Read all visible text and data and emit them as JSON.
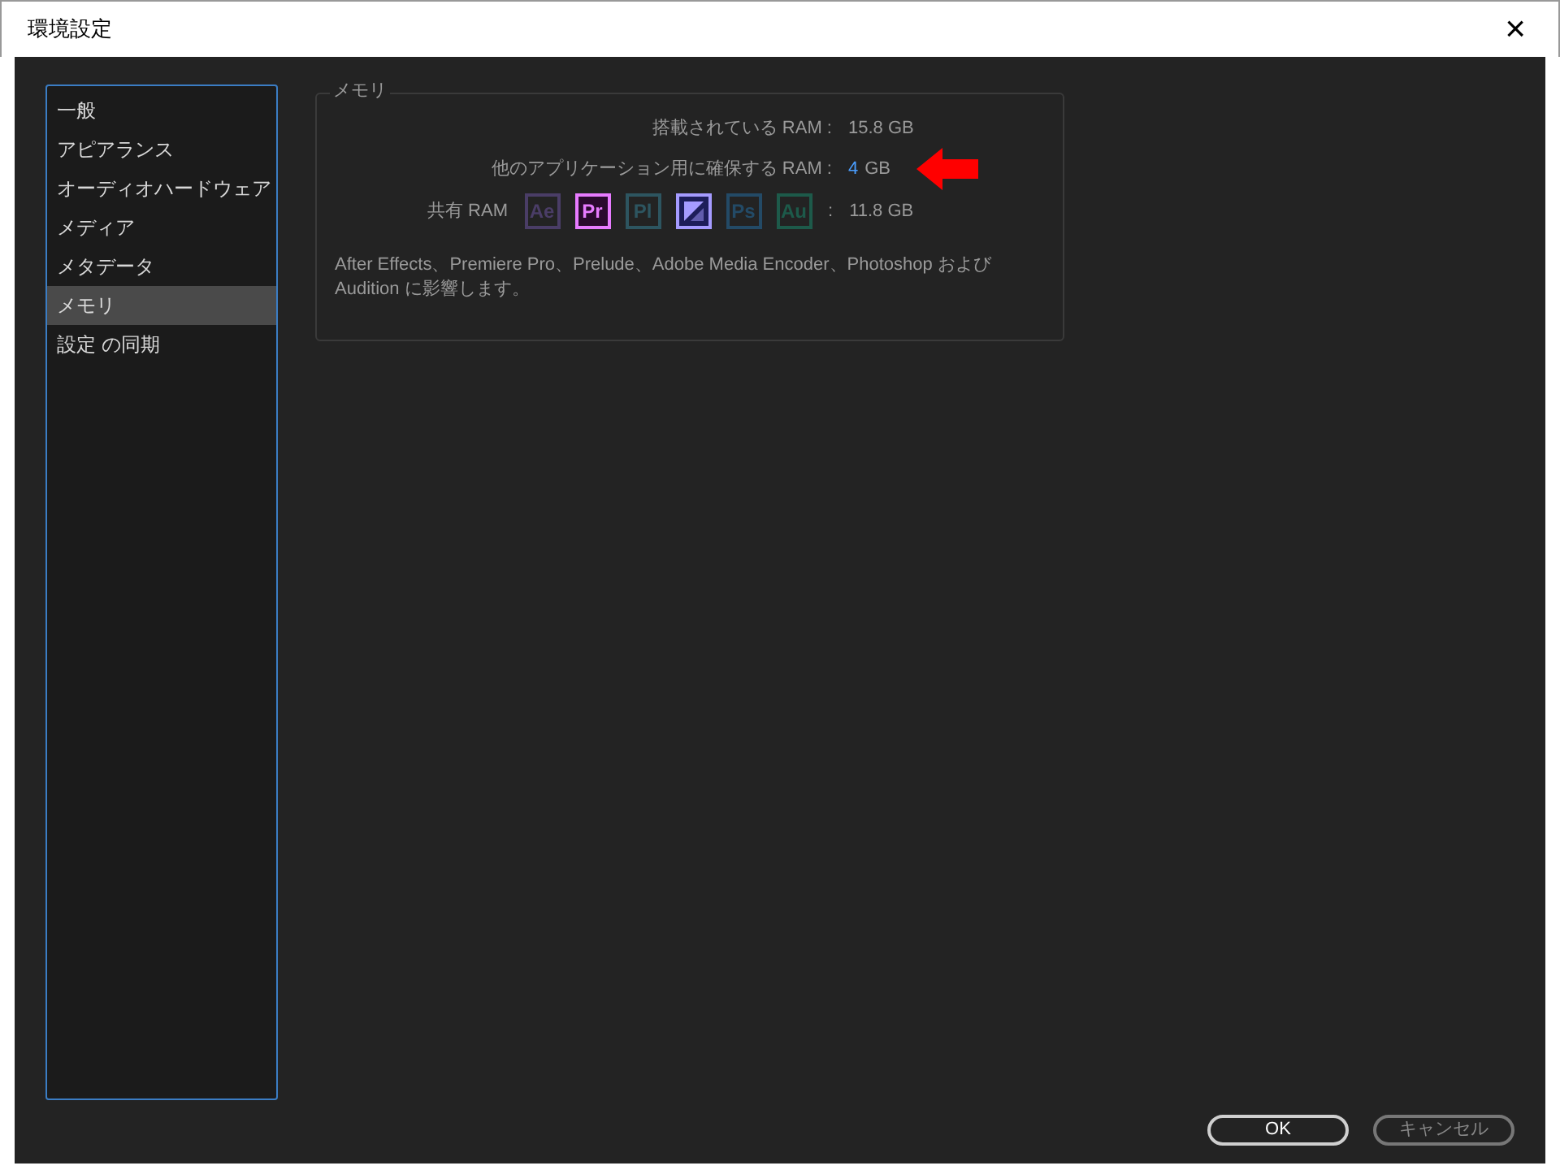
{
  "window": {
    "title": "環境設定",
    "close": "×"
  },
  "sidebar": {
    "items": [
      {
        "label": "一般",
        "selected": false
      },
      {
        "label": "アピアランス",
        "selected": false
      },
      {
        "label": "オーディオハードウェア",
        "selected": false
      },
      {
        "label": "メディア",
        "selected": false
      },
      {
        "label": "メタデータ",
        "selected": false
      },
      {
        "label": "メモリ",
        "selected": true
      },
      {
        "label": "設定 の同期",
        "selected": false
      }
    ]
  },
  "memory": {
    "title": "メモリ",
    "installed_label": "搭載されている RAM :",
    "installed_value": "15.8 GB",
    "reserved_label": "他のアプリケーション用に確保する RAM :",
    "reserved_value": "4",
    "reserved_unit": "GB",
    "shared_label": "共有 RAM",
    "apps": [
      {
        "kind": "text",
        "label": "Ae",
        "color": "#4a3d66",
        "active": false
      },
      {
        "kind": "text",
        "label": "Pr",
        "color": "#e77bff",
        "active": true
      },
      {
        "kind": "text",
        "label": "Pl",
        "color": "#2d5560",
        "active": false
      },
      {
        "kind": "encoder",
        "color": "#a59bff",
        "active": true
      },
      {
        "kind": "text",
        "label": "Ps",
        "color": "#234a66",
        "active": false
      },
      {
        "kind": "text",
        "label": "Au",
        "color": "#1d5a4a",
        "active": false
      }
    ],
    "shared_sep": ":",
    "shared_value": "11.8 GB",
    "note": "After  Effects、Premiere Pro、Prelude、Adobe Media Encoder、Photoshop および Audition に影響します。"
  },
  "buttons": [
    {
      "label": "OK",
      "disabled": false
    },
    {
      "label": "キャンセル",
      "disabled": true
    }
  ]
}
